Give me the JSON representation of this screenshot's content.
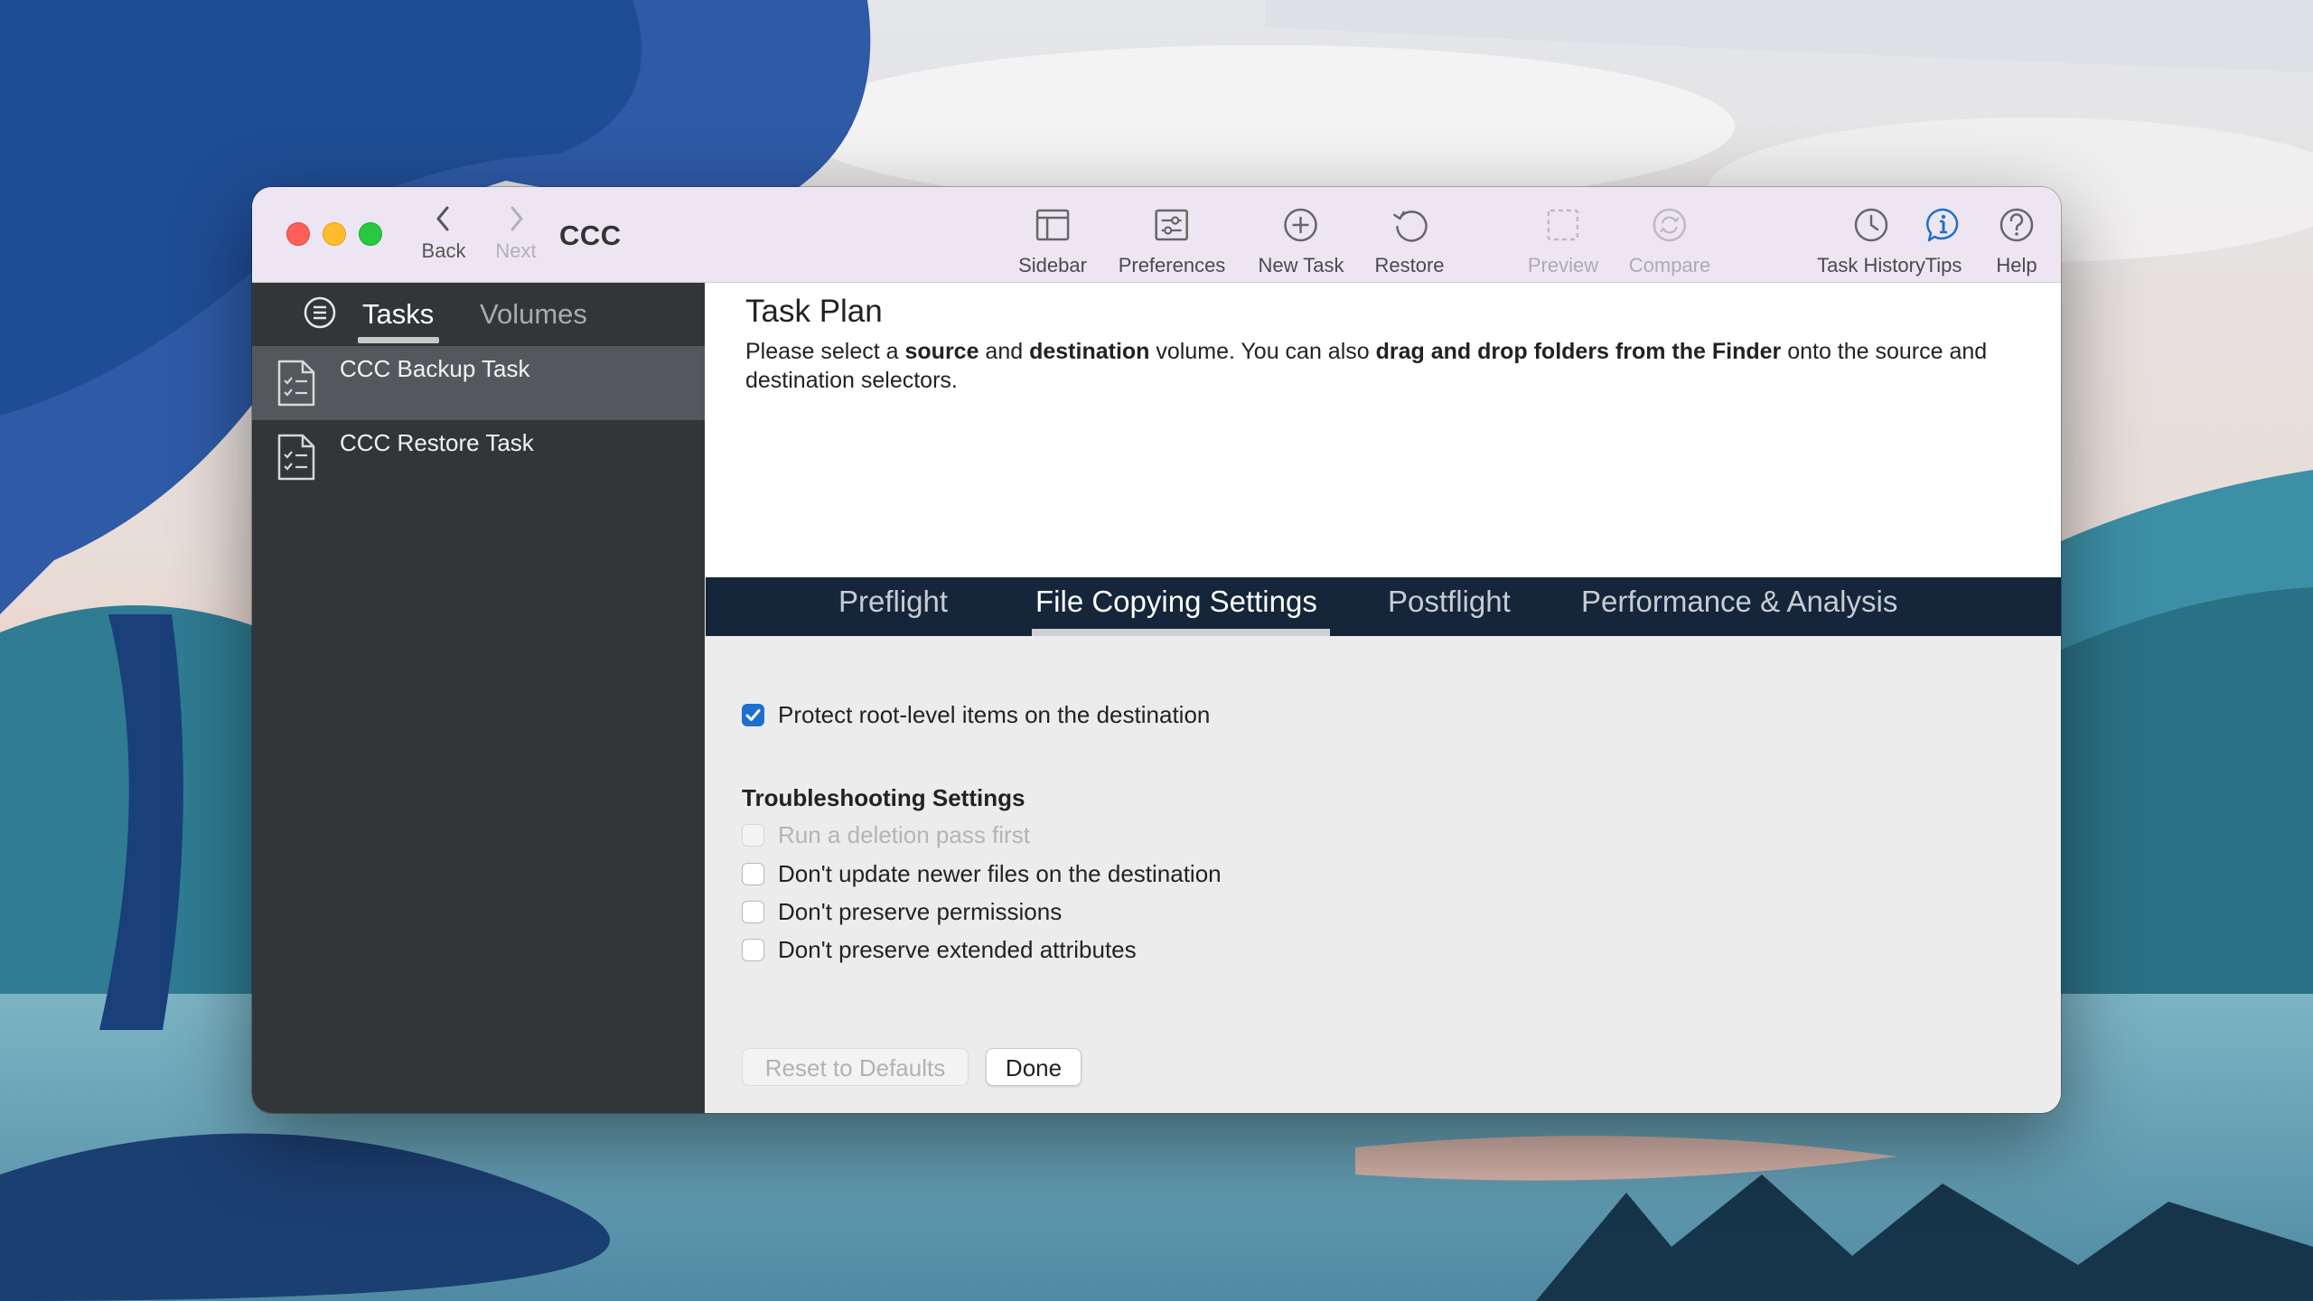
{
  "window": {
    "title": "CCC"
  },
  "nav": {
    "back_label": "Back",
    "next_label": "Next"
  },
  "toolbar": {
    "items": [
      {
        "label": "Sidebar",
        "icon": "sidebar-icon",
        "enabled": true
      },
      {
        "label": "Preferences",
        "icon": "preferences-icon",
        "enabled": true
      },
      {
        "label": "New Task",
        "icon": "plus-circle-icon",
        "enabled": true
      },
      {
        "label": "Restore",
        "icon": "restore-icon",
        "enabled": true
      },
      {
        "label": "Preview",
        "icon": "preview-icon",
        "enabled": false
      },
      {
        "label": "Compare",
        "icon": "compare-icon",
        "enabled": false
      },
      {
        "label": "Task History",
        "icon": "clock-icon",
        "enabled": true
      },
      {
        "label": "Tips",
        "icon": "info-bubble-icon",
        "enabled": true
      },
      {
        "label": "Help",
        "icon": "question-icon",
        "enabled": true
      }
    ]
  },
  "sidebar": {
    "tabs": [
      "Tasks",
      "Volumes"
    ],
    "active_tab": "Tasks",
    "tasks": [
      {
        "name": "CCC Backup Task",
        "selected": true
      },
      {
        "name": "CCC Restore Task",
        "selected": false
      }
    ]
  },
  "main": {
    "title": "Task Plan",
    "desc": {
      "p1": "Please select a ",
      "b1": "source",
      "p2": " and ",
      "b2": "destination",
      "p3": " volume. You can also ",
      "b3": "drag and drop folders from the Finder",
      "p4": " onto the source and destination selectors."
    },
    "tabs": [
      "Preflight",
      "File Copying Settings",
      "Postflight",
      "Performance & Analysis"
    ],
    "active_tab": "File Copying Settings",
    "protect_option": {
      "label": "Protect root-level items on the destination",
      "checked": true
    },
    "troubleshooting": {
      "heading": "Troubleshooting Settings",
      "options": [
        {
          "label": "Run a deletion pass first",
          "checked": false,
          "enabled": false
        },
        {
          "label": "Don't update newer files on the destination",
          "checked": false,
          "enabled": true
        },
        {
          "label": "Don't preserve permissions",
          "checked": false,
          "enabled": true
        },
        {
          "label": "Don't preserve extended attributes",
          "checked": false,
          "enabled": true
        }
      ]
    },
    "buttons": {
      "reset_label": "Reset to Defaults",
      "done_label": "Done"
    }
  },
  "colors": {
    "toolbar_bg": "#ede6f2",
    "sidebar_bg": "#333639",
    "tabbar_bg": "#15253a",
    "accent": "#1f6fd0",
    "tips_blue": "#1e6fc8"
  }
}
